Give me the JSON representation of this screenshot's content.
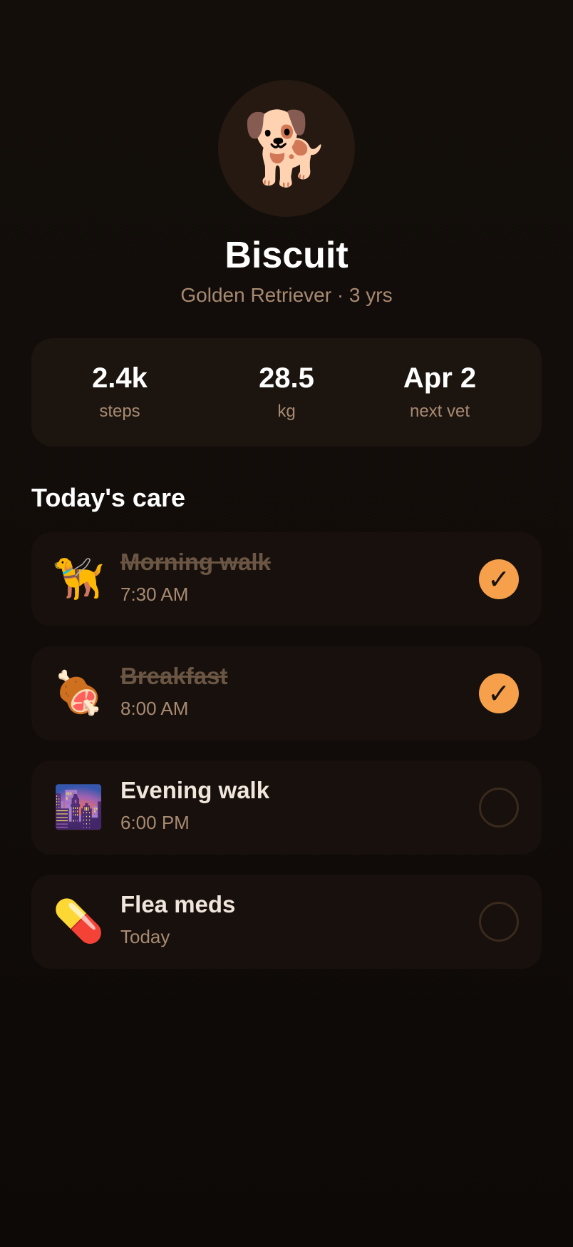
{
  "profile": {
    "avatar_emoji": "🐕",
    "avatar_icon": "dog-icon",
    "name": "Biscuit",
    "meta": "Golden Retriever · 3 yrs"
  },
  "stats": [
    {
      "value": "2.4k",
      "label": "steps"
    },
    {
      "value": "28.5",
      "label": "kg"
    },
    {
      "value": "Apr 2",
      "label": "next vet"
    }
  ],
  "care_section": {
    "title": "Today's care",
    "items": [
      {
        "icon": "🦮",
        "icon_name": "guide-dog-icon",
        "title": "Morning walk",
        "time": "7:30 AM",
        "done": true
      },
      {
        "icon": "🍖",
        "icon_name": "meat-on-bone-icon",
        "title": "Breakfast",
        "time": "8:00 AM",
        "done": true
      },
      {
        "icon": "🌆",
        "icon_name": "city-dusk-icon",
        "title": "Evening walk",
        "time": "6:00 PM",
        "done": false
      },
      {
        "icon": "💊",
        "icon_name": "pill-icon",
        "title": "Flea meds",
        "time": "Today",
        "done": false
      }
    ]
  },
  "check_glyph": "✓",
  "colors": {
    "background": "#120d09",
    "card": "#1b140f",
    "accent": "#f6a04b",
    "muted_text": "#a88a72",
    "done_text": "#6b5644"
  }
}
